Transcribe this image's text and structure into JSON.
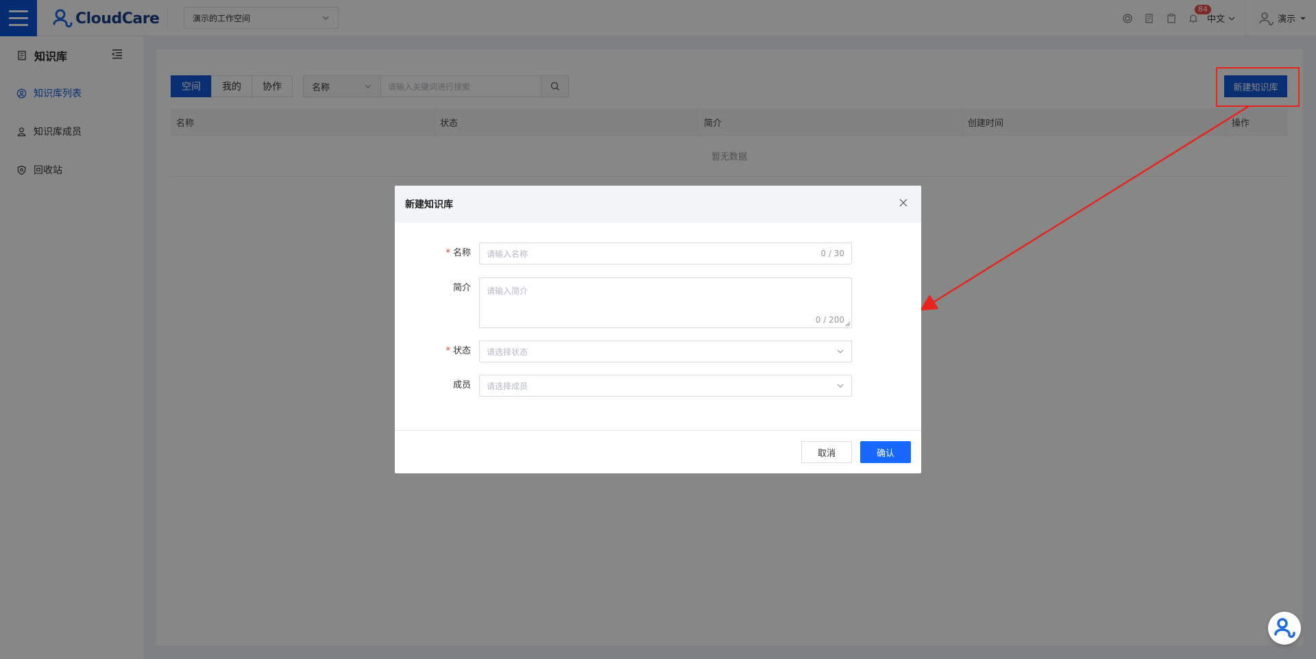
{
  "header": {
    "logo_text": "CloudCare",
    "workspace": "演示的工作空间",
    "notification_count": "84",
    "language": "中文",
    "user_name": "演示"
  },
  "sidebar": {
    "title": "知识库",
    "items": [
      {
        "label": "知识库列表",
        "icon": "user-circle-icon",
        "active": true
      },
      {
        "label": "知识库成员",
        "icon": "members-icon",
        "active": false
      },
      {
        "label": "回收站",
        "icon": "recycle-icon",
        "active": false
      }
    ]
  },
  "content": {
    "tabs": [
      "空间",
      "我的",
      "协作"
    ],
    "search_field": "名称",
    "search_placeholder": "请输入关键词进行搜索",
    "new_button": "新建知识库",
    "columns": [
      "名称",
      "状态",
      "简介",
      "创建时间",
      "操作"
    ],
    "empty_text": "暂无数据"
  },
  "dialog": {
    "title": "新建知识库",
    "fields": {
      "name": {
        "label": "名称",
        "placeholder": "请输入名称",
        "counter": "0 / 30",
        "required": true
      },
      "intro": {
        "label": "简介",
        "placeholder": "请输入简介",
        "counter": "0 / 200",
        "required": false
      },
      "status": {
        "label": "状态",
        "placeholder": "请选择状态",
        "required": true
      },
      "members": {
        "label": "成员",
        "placeholder": "请选择成员",
        "required": false
      }
    },
    "cancel_label": "取消",
    "confirm_label": "确认"
  },
  "colors": {
    "primary": "#1159d8",
    "confirm": "#1668ff",
    "annotation": "#e8241c",
    "badge": "#f04848"
  }
}
